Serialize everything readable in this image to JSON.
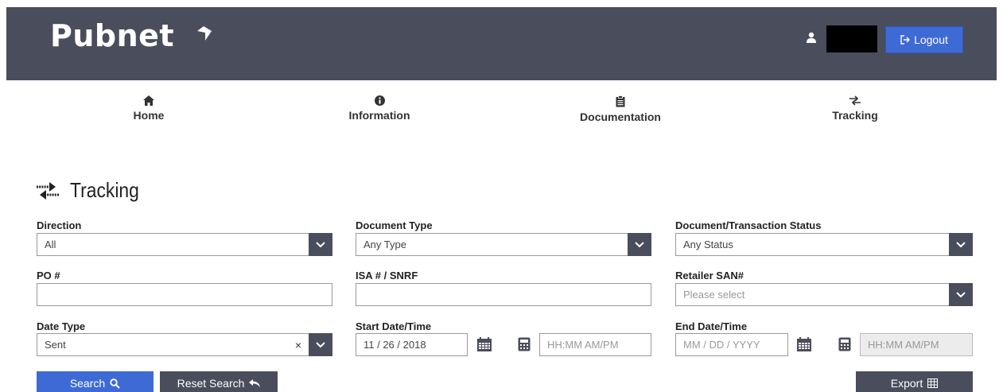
{
  "header": {
    "logo_text": "Pubnet",
    "logout_label": "Logout"
  },
  "nav": {
    "items": [
      {
        "label": "Home",
        "icon": "home-icon"
      },
      {
        "label": "Information",
        "icon": "info-icon"
      },
      {
        "label": "Documentation",
        "icon": "clipboard-icon"
      },
      {
        "label": "Tracking",
        "icon": "exchange-icon"
      }
    ]
  },
  "page": {
    "title": "Tracking"
  },
  "filters": {
    "direction": {
      "label": "Direction",
      "value": "All"
    },
    "document_type": {
      "label": "Document Type",
      "value": "Any Type"
    },
    "status": {
      "label": "Document/Transaction Status",
      "value": "Any Status"
    },
    "po": {
      "label": "PO #",
      "value": ""
    },
    "isa": {
      "label": "ISA # / SNRF",
      "value": ""
    },
    "retailer_san": {
      "label": "Retailer SAN#",
      "placeholder": "Please select"
    },
    "date_type": {
      "label": "Date Type",
      "value": "Sent",
      "clear": "×"
    },
    "start": {
      "label": "Start Date/Time",
      "date_value": "11 / 26 / 2018",
      "time_placeholder": "HH:MM AM/PM"
    },
    "end": {
      "label": "End Date/Time",
      "date_placeholder": "MM / DD / YYYY",
      "time_placeholder": "HH:MM AM/PM"
    }
  },
  "actions": {
    "search_label": "Search",
    "reset_label": "Reset Search",
    "export_label": "Export"
  },
  "colors": {
    "header_bg": "#4a4d5b",
    "primary_blue": "#3e6ad6"
  }
}
